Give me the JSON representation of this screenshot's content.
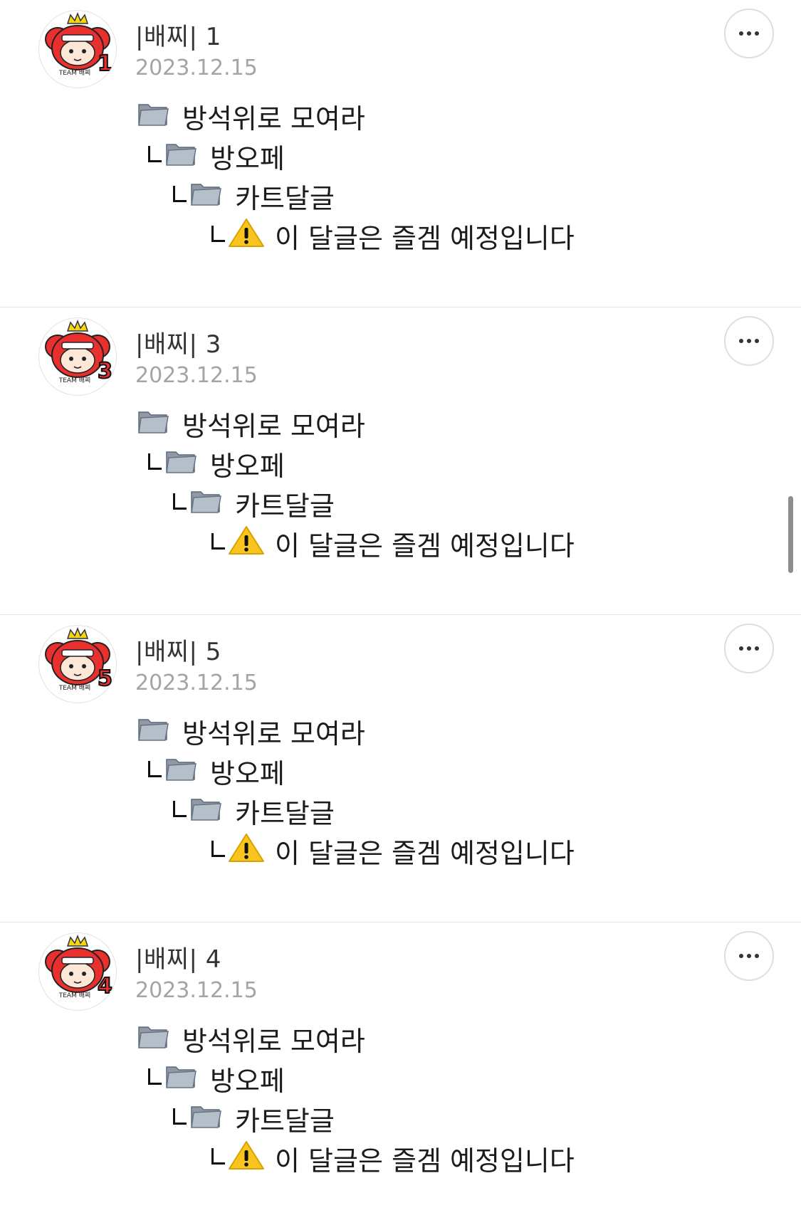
{
  "comments": [
    {
      "author": "|배찌| 1",
      "avatar_number": "1",
      "avatar_badge": "TEAM 배찌",
      "date": "2023.12.15",
      "lines": [
        "방석위로 모여라",
        "방오페",
        "카트달글",
        "이 달글은 즐겜 예정입니다"
      ]
    },
    {
      "author": "|배찌| 3",
      "avatar_number": "3",
      "avatar_badge": "TEAM 배찌",
      "date": "2023.12.15",
      "lines": [
        "방석위로 모여라",
        "방오페",
        "카트달글",
        "이 달글은 즐겜 예정입니다"
      ]
    },
    {
      "author": "|배찌| 5",
      "avatar_number": "5",
      "avatar_badge": "TEAM 배찌",
      "date": "2023.12.15",
      "lines": [
        "방석위로 모여라",
        "방오페",
        "카트달글",
        "이 달글은 즐겜 예정입니다"
      ]
    },
    {
      "author": "|배찌| 4",
      "avatar_number": "4",
      "avatar_badge": "TEAM 배찌",
      "date": "2023.12.15",
      "lines": [
        "방석위로 모여라",
        "방오페",
        "카트달글",
        "이 달글은 즐겜 예정입니다"
      ]
    }
  ],
  "icons": {
    "folder": "folder-icon",
    "warning": "warning-icon",
    "more": "more-icon"
  },
  "colors": {
    "avatar_red": "#e8302e",
    "crown_yellow": "#f5d416",
    "warning_yellow": "#f7c51e",
    "date_gray": "#a3a3a8"
  }
}
